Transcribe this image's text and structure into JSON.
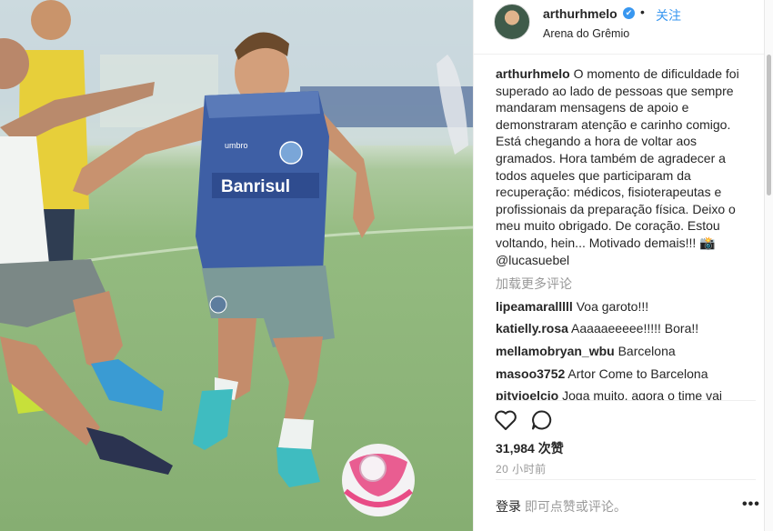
{
  "header": {
    "username": "arthurhmelo",
    "separator": "•",
    "follow_label": "关注",
    "location": "Arena do Grêmio"
  },
  "caption": {
    "username": "arthurhmelo",
    "text": "O momento de dificuldade foi superado ao lado de pessoas que sempre mandaram mensagens de apoio e demonstraram atenção e carinho comigo. Está chegando a hora de voltar aos gramados. Hora também de agradecer a todos aqueles que participaram da recuperação: médicos, fisioterapeutas e profissionais da preparação física. Deixo o meu muito obrigado. De coração. Estou voltando, hein... Motivado demais!!! 📸 @lucasuebel"
  },
  "load_more_label": "加载更多评论",
  "comments": [
    {
      "user": "lipeamaralllll",
      "text": "Voa garoto!!!"
    },
    {
      "user": "katielly.rosa",
      "text": "Aaaaaeeeee!!!!! Bora!!"
    },
    {
      "user": "mellamobryan_wbu",
      "text": "Barcelona"
    },
    {
      "user": "masoo3752",
      "text": "Artor Come to Barcelona"
    },
    {
      "user": "pityjoelcio",
      "text": "Joga muito, agora o time vai"
    }
  ],
  "likes_label": "31,984 次赞",
  "timestamp": "20 小时前",
  "footer": {
    "login_label": "登录",
    "prompt": " 即可点赞或评论。",
    "more_icon_label": "•••"
  },
  "photo": {
    "sponsor_text": "Banrisul",
    "kit_brand": "umbro"
  },
  "icons": {
    "like": "heart-outline-icon",
    "comment": "speech-bubble-icon",
    "verified": "verified-badge-icon",
    "more": "more-options-icon"
  },
  "colors": {
    "link_blue": "#3897f0",
    "muted_gray": "#999999",
    "jersey_blue": "#3e5fa5",
    "ball_pink": "#e84c86"
  }
}
